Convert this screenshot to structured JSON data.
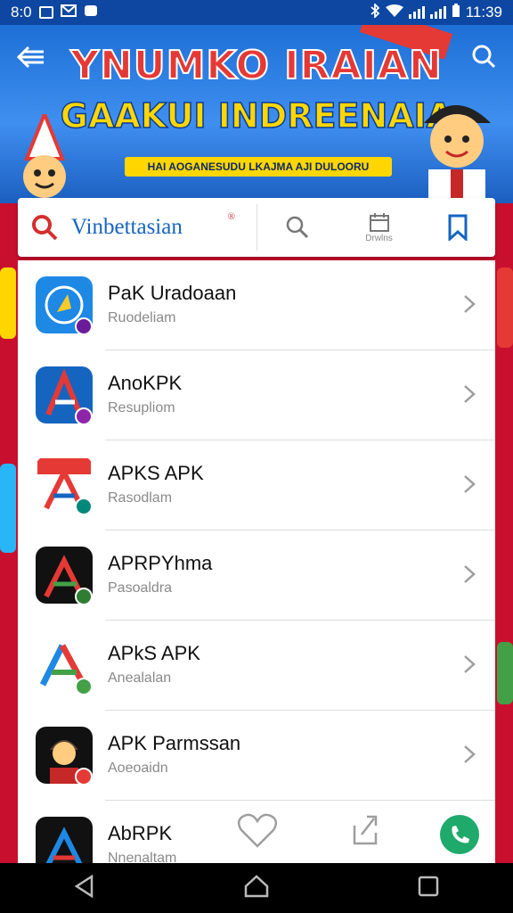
{
  "status_bar": {
    "time_left": "8:0",
    "time_right": "11:39"
  },
  "banner": {
    "title": "YNUMKO IRAIAN",
    "subtitle": "GAAKUI INDREENAIA",
    "strip_text": "HAI AOGANESUDU LKAJMA AJI DULOORU"
  },
  "search_bar": {
    "brand": "Vinbettasian",
    "registered_mark": "®",
    "tool_label": "Drwlns"
  },
  "apps": [
    {
      "name": "PaK Uradoaan",
      "subtitle": "Ruodeliam",
      "icon": "compass-app-icon",
      "badge_color": "#6a1b9a"
    },
    {
      "name": "AnoKPK",
      "subtitle": "Resupliom",
      "icon": "a-logo-blue-icon",
      "badge_color": "#8e24aa"
    },
    {
      "name": "APKS APK",
      "subtitle": "Rasodlam",
      "icon": "a-logo-red-icon",
      "badge_color": "#00897b"
    },
    {
      "name": "APRPYhma",
      "subtitle": "Pasoaldra",
      "icon": "a-logo-black-icon",
      "badge_color": "#2e7d32"
    },
    {
      "name": "APkS APK",
      "subtitle": "Anealalan",
      "icon": "a-logo-color-icon",
      "badge_color": "#43a047"
    },
    {
      "name": "APK Parmssan",
      "subtitle": "Aoeoaidn",
      "icon": "boy-avatar-icon",
      "badge_color": "#e53935"
    },
    {
      "name": "AbRPK",
      "subtitle": "Nnenaltam",
      "icon": "a-logo-dark-icon",
      "badge_color": "#1565c0"
    }
  ],
  "colors": {
    "status_bar": "#0d47a1",
    "accent_red": "#d32f2f",
    "brand_blue": "#1565c0",
    "call_green": "#1faa6b"
  }
}
